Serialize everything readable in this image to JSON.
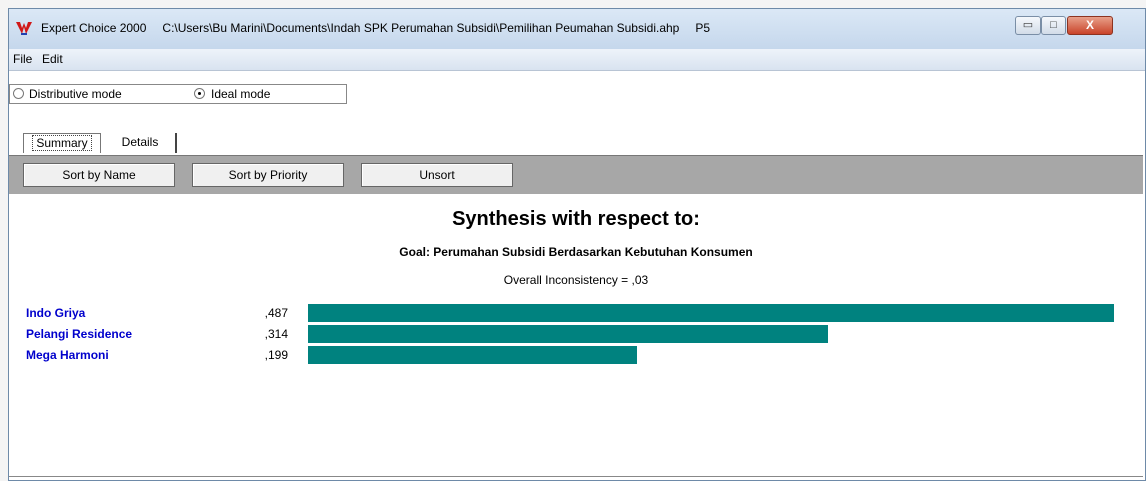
{
  "window": {
    "app_name": "Expert Choice 2000",
    "file_path": "C:\\Users\\Bu Marini\\Documents\\Indah SPK Perumahan Subsidi\\Pemilihan Peumahan Subsidi.ahp",
    "node": "P5",
    "minimize_glyph": "▭",
    "maximize_glyph": "□",
    "close_glyph": "X"
  },
  "menu": {
    "items": [
      "File",
      "Edit"
    ]
  },
  "modes": {
    "distributive_label": "Distributive mode",
    "ideal_label": "Ideal mode",
    "selected": "ideal"
  },
  "tabs": [
    {
      "label": "Summary",
      "active": true
    },
    {
      "label": "Details",
      "active": false
    }
  ],
  "toolbar": {
    "sort_name": "Sort by Name",
    "sort_priority": "Sort by Priority",
    "unsort": "Unsort"
  },
  "synthesis": {
    "title": "Synthesis with respect to:",
    "goal": "Goal: Perumahan Subsidi Berdasarkan Kebutuhan Konsumen",
    "inconsistency": "Overall Inconsistency = ,03",
    "alternatives": [
      {
        "name": "Indo Griya",
        "value_label": ",487",
        "value": 0.487
      },
      {
        "name": "Pelangi Residence",
        "value_label": ",314",
        "value": 0.314
      },
      {
        "name": "Mega Harmoni",
        "value_label": ",199",
        "value": 0.199
      }
    ]
  },
  "colors": {
    "bar": "#00827f",
    "names": "#0000cc"
  }
}
